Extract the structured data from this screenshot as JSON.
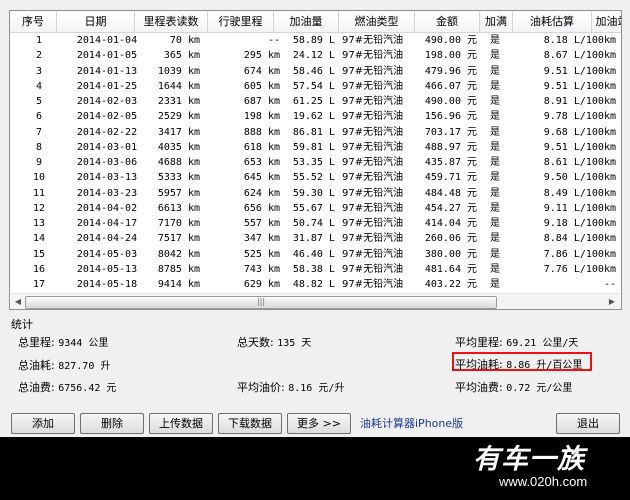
{
  "table": {
    "headers": [
      "序号",
      "日期",
      "里程表读数",
      "行驶里程",
      "加油量",
      "燃油类型",
      "金额",
      "加满",
      "油耗估算",
      "加油站"
    ],
    "rows": [
      {
        "no": "1",
        "date": "2014-01-04",
        "odo": "70 km",
        "trip": "--",
        "fuel": "58.89 L",
        "type": "97#无铅汽油",
        "amount": "490.00 元",
        "full": "是",
        "est": "8.18 L/100km"
      },
      {
        "no": "2",
        "date": "2014-01-05",
        "odo": "365 km",
        "trip": "295 km",
        "fuel": "24.12 L",
        "type": "97#无铅汽油",
        "amount": "198.00 元",
        "full": "是",
        "est": "8.67 L/100km"
      },
      {
        "no": "3",
        "date": "2014-01-13",
        "odo": "1039 km",
        "trip": "674 km",
        "fuel": "58.46 L",
        "type": "97#无铅汽油",
        "amount": "479.96 元",
        "full": "是",
        "est": "9.51 L/100km"
      },
      {
        "no": "4",
        "date": "2014-01-25",
        "odo": "1644 km",
        "trip": "605 km",
        "fuel": "57.54 L",
        "type": "97#无铅汽油",
        "amount": "466.07 元",
        "full": "是",
        "est": "9.51 L/100km"
      },
      {
        "no": "5",
        "date": "2014-02-03",
        "odo": "2331 km",
        "trip": "687 km",
        "fuel": "61.25 L",
        "type": "97#无铅汽油",
        "amount": "490.00 元",
        "full": "是",
        "est": "8.91 L/100km"
      },
      {
        "no": "6",
        "date": "2014-02-05",
        "odo": "2529 km",
        "trip": "198 km",
        "fuel": "19.62 L",
        "type": "97#无铅汽油",
        "amount": "156.96 元",
        "full": "是",
        "est": "9.78 L/100km"
      },
      {
        "no": "7",
        "date": "2014-02-22",
        "odo": "3417 km",
        "trip": "888 km",
        "fuel": "86.81 L",
        "type": "97#无铅汽油",
        "amount": "703.17 元",
        "full": "是",
        "est": "9.68 L/100km"
      },
      {
        "no": "8",
        "date": "2014-03-01",
        "odo": "4035 km",
        "trip": "618 km",
        "fuel": "59.81 L",
        "type": "97#无铅汽油",
        "amount": "488.97 元",
        "full": "是",
        "est": "9.51 L/100km"
      },
      {
        "no": "9",
        "date": "2014-03-06",
        "odo": "4688 km",
        "trip": "653 km",
        "fuel": "53.35 L",
        "type": "97#无铅汽油",
        "amount": "435.87 元",
        "full": "是",
        "est": "8.61 L/100km"
      },
      {
        "no": "10",
        "date": "2014-03-13",
        "odo": "5333 km",
        "trip": "645 km",
        "fuel": "55.52 L",
        "type": "97#无铅汽油",
        "amount": "459.71 元",
        "full": "是",
        "est": "9.50 L/100km"
      },
      {
        "no": "11",
        "date": "2014-03-23",
        "odo": "5957 km",
        "trip": "624 km",
        "fuel": "59.30 L",
        "type": "97#无铅汽油",
        "amount": "484.48 元",
        "full": "是",
        "est": "8.49 L/100km"
      },
      {
        "no": "12",
        "date": "2014-04-02",
        "odo": "6613 km",
        "trip": "656 km",
        "fuel": "55.67 L",
        "type": "97#无铅汽油",
        "amount": "454.27 元",
        "full": "是",
        "est": "9.11 L/100km"
      },
      {
        "no": "13",
        "date": "2014-04-17",
        "odo": "7170 km",
        "trip": "557 km",
        "fuel": "50.74 L",
        "type": "97#无铅汽油",
        "amount": "414.04 元",
        "full": "是",
        "est": "9.18 L/100km"
      },
      {
        "no": "14",
        "date": "2014-04-24",
        "odo": "7517 km",
        "trip": "347 km",
        "fuel": "31.87 L",
        "type": "97#无铅汽油",
        "amount": "260.06 元",
        "full": "是",
        "est": "8.84 L/100km"
      },
      {
        "no": "15",
        "date": "2014-05-03",
        "odo": "8042 km",
        "trip": "525 km",
        "fuel": "46.40 L",
        "type": "97#无铅汽油",
        "amount": "380.00 元",
        "full": "是",
        "est": "7.86 L/100km"
      },
      {
        "no": "16",
        "date": "2014-05-13",
        "odo": "8785 km",
        "trip": "743 km",
        "fuel": "58.38 L",
        "type": "97#无铅汽油",
        "amount": "481.64 元",
        "full": "是",
        "est": "7.76 L/100km"
      },
      {
        "no": "17",
        "date": "2014-05-18",
        "odo": "9414 km",
        "trip": "629 km",
        "fuel": "48.82 L",
        "type": "97#无铅汽油",
        "amount": "403.22 元",
        "full": "是",
        "est": "--"
      }
    ]
  },
  "stats": {
    "title": "统计",
    "total_mileage": {
      "label": "总里程:",
      "value": "9344 公里"
    },
    "total_days": {
      "label": "总天数:",
      "value": "135 天"
    },
    "avg_mileage": {
      "label": "平均里程:",
      "value": "69.21 公里/天"
    },
    "total_fuel": {
      "label": "总油耗:",
      "value": "827.70 升"
    },
    "avg_consumption": {
      "label": "平均油耗:",
      "value": "8.86 升/百公里"
    },
    "total_cost": {
      "label": "总油费:",
      "value": "6756.42 元"
    },
    "avg_price": {
      "label": "平均油价:",
      "value": "8.16 元/升"
    },
    "avg_cost": {
      "label": "平均油费:",
      "value": "0.72 元/公里"
    }
  },
  "buttons": {
    "add": "添加",
    "delete": "删除",
    "upload": "上传数据",
    "download": "下载数据",
    "more": "更多 >>",
    "exit": "退出"
  },
  "app_label": "油耗计算器iPhone版",
  "watermark": {
    "logo": "有车一族",
    "url": "www.020h.com"
  },
  "colors": {
    "highlight": "#ee1111",
    "link": "#1a3a9a"
  }
}
